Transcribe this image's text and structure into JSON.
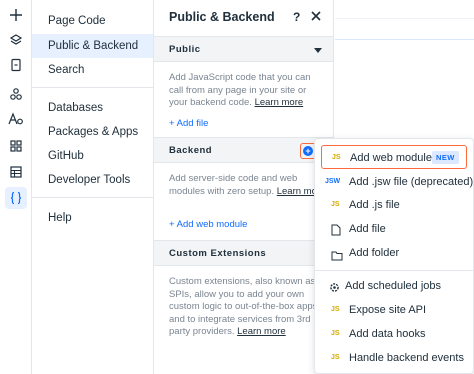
{
  "colors": {
    "accent": "#116dff",
    "highlight_border": "#ff6a3d",
    "js_icon": "#d4a800",
    "selected_bg": "#e7f0ff"
  },
  "rail": {
    "icons": [
      "plus-icon",
      "layers-icon",
      "page-icon",
      "apps-icon",
      "text-style-icon",
      "grid-icon",
      "table-icon",
      "code-braces-icon"
    ],
    "active_icon": "code-braces-icon"
  },
  "nav": {
    "items": [
      {
        "label": "Page Code"
      },
      {
        "label": "Public & Backend"
      },
      {
        "label": "Search"
      },
      {
        "label": "Databases"
      },
      {
        "label": "Packages & Apps"
      },
      {
        "label": "GitHub"
      },
      {
        "label": "Developer Tools"
      },
      {
        "label": "Help"
      }
    ],
    "selected": "Public & Backend"
  },
  "panel": {
    "title": "Public & Backend",
    "help": "?",
    "public": {
      "heading": "Public",
      "description": "Add JavaScript code that you can call from any page in your site or your backend code.",
      "learn_more": "Learn more",
      "add_link": "+ Add file"
    },
    "backend": {
      "heading": "Backend",
      "description": "Add server-side code and web modules with zero setup.",
      "learn_more": "Learn more",
      "add_link": "+ Add web module"
    },
    "custom_extensions": {
      "heading": "Custom Extensions",
      "description": "Custom extensions, also known as SPIs, allow you to add your own custom logic to out-of-the-box apps and to integrate services from 3rd party providers.",
      "learn_more": "Learn more"
    }
  },
  "menu": {
    "items": [
      {
        "icon_text": "JS",
        "label": "Add web module",
        "badge": "NEW"
      },
      {
        "icon_text": "JSW",
        "label": "Add .jsw file (deprecated)"
      },
      {
        "icon_text": "JS",
        "label": "Add .js file"
      },
      {
        "icon_text": "",
        "label": "Add file"
      },
      {
        "icon_text": "",
        "label": "Add folder"
      },
      {
        "icon_text": "",
        "label": "Add scheduled jobs"
      },
      {
        "icon_text": "JS",
        "label": "Expose site API"
      },
      {
        "icon_text": "JS",
        "label": "Add data hooks"
      },
      {
        "icon_text": "JS",
        "label": "Handle backend events"
      }
    ]
  }
}
